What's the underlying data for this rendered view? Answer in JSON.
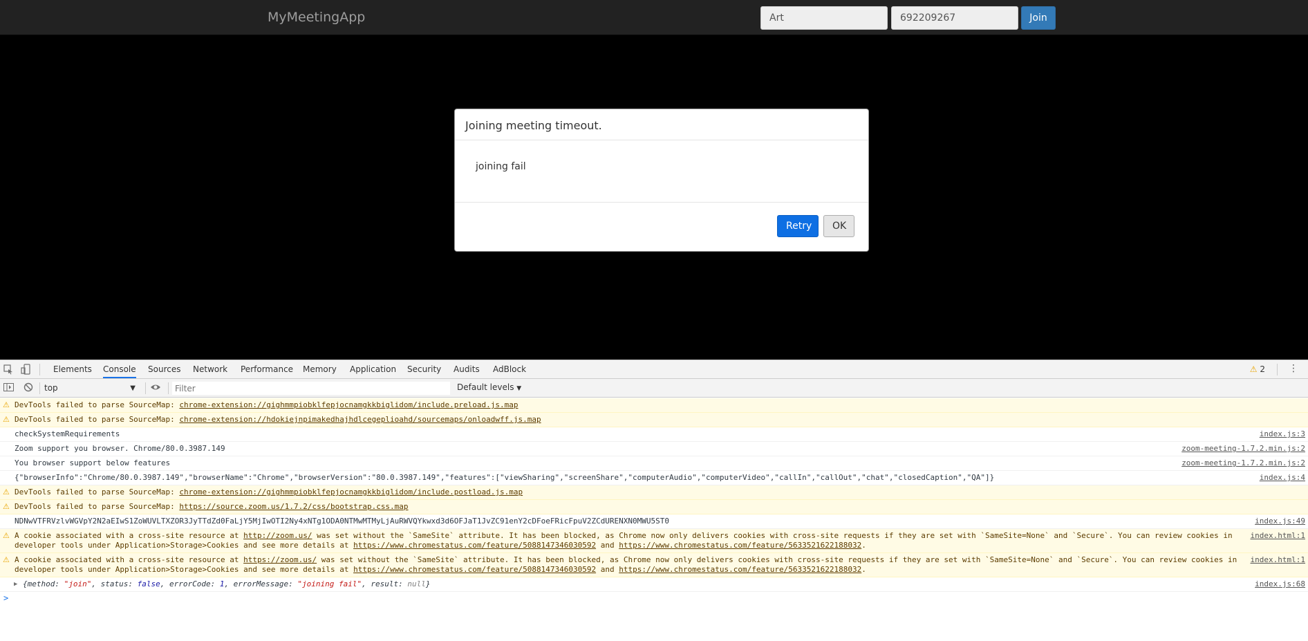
{
  "app": {
    "brand": "MyMeetingApp",
    "name_value": "Art",
    "meeting_value": "692209267",
    "join_label": "Join"
  },
  "modal": {
    "title": "Joining meeting timeout.",
    "body": "joining fail",
    "retry_label": "Retry",
    "ok_label": "OK"
  },
  "devtools": {
    "tabs": [
      "Elements",
      "Console",
      "Sources",
      "Network",
      "Performance",
      "Memory",
      "Application",
      "Security",
      "Audits",
      "AdBlock"
    ],
    "active_tab": "Console",
    "warning_count": "2",
    "context": "top",
    "filter_placeholder": "Filter",
    "levels": "Default levels"
  },
  "console": {
    "r1": {
      "text": "DevTools failed to parse SourceMap: ",
      "link": "chrome-extension://gighmmpiobklfepjocnamgkkbiglidom/include.preload.js.map"
    },
    "r2": {
      "text": "DevTools failed to parse SourceMap: ",
      "link": "chrome-extension://hdokiejnpimakedhajhdlcegeplioahd/sourcemaps/onloadwff.js.map"
    },
    "r3": {
      "text": "checkSystemRequirements",
      "src": "index.js:3"
    },
    "r4": {
      "text": "Zoom support you browser. Chrome/80.0.3987.149",
      "src": "zoom-meeting-1.7.2.min.js:2"
    },
    "r5": {
      "text": "You browser support below features",
      "src": "zoom-meeting-1.7.2.min.js:2"
    },
    "r6": {
      "text": "{\"browserInfo\":\"Chrome/80.0.3987.149\",\"browserName\":\"Chrome\",\"browserVersion\":\"80.0.3987.149\",\"features\":[\"viewSharing\",\"screenShare\",\"computerAudio\",\"computerVideo\",\"callIn\",\"callOut\",\"chat\",\"closedCaption\",\"QA\"]}",
      "src": "index.js:4"
    },
    "r7": {
      "text": "DevTools failed to parse SourceMap: ",
      "link": "chrome-extension://gighmmpiobklfepjocnamgkkbiglidom/include.postload.js.map"
    },
    "r8": {
      "text": "DevTools failed to parse SourceMap: ",
      "link": "https://source.zoom.us/1.7.2/css/bootstrap.css.map"
    },
    "r9": {
      "text": "NDNwVTFRVzlvWGVpY2N2aEIwS1ZoWUVLTXZOR3JyTTdZd0FaLjY5MjIwOTI2Ny4xNTg1ODA0NTMwMTMyLjAuRWVQYkwxd3d6OFJaT1JvZC91enY2cDFoeFRicFpuV2ZCdURENXN0MWU5ST0",
      "src": "index.js:49"
    },
    "r10": {
      "a": "A cookie associated with a cross-site resource at ",
      "l1": "http://zoom.us/",
      "b": " was set without the `SameSite` attribute. It has been blocked, as Chrome now only delivers cookies with cross-site requests if they are set with `SameSite=None` and `Secure`. You can review cookies in",
      "c": "developer tools under Application>Storage>Cookies and see more details at ",
      "l2": "https://www.chromestatus.com/feature/5088147346030592",
      "d": " and ",
      "l3": "https://www.chromestatus.com/feature/5633521622188032",
      "e": ".",
      "src": "index.html:1"
    },
    "r11": {
      "a": "A cookie associated with a cross-site resource at ",
      "l1": "https://zoom.us/",
      "b": " was set without the `SameSite` attribute. It has been blocked, as Chrome now only delivers cookies with cross-site requests if they are set with `SameSite=None` and `Secure`. You can review cookies in",
      "c": "developer tools under Application>Storage>Cookies and see more details at ",
      "l2": "https://www.chromestatus.com/feature/5088147346030592",
      "d": " and ",
      "l3": "https://www.chromestatus.com/feature/5633521622188032",
      "e": ".",
      "src": "index.html:1"
    },
    "r12": {
      "p1": "{method: ",
      "v1": "\"join\"",
      "p2": ", status: ",
      "v2": "false",
      "p3": ", errorCode: ",
      "v3": "1",
      "p4": ", errorMessage: ",
      "v4": "\"joining fail\"",
      "p5": ", result: ",
      "v5": "null",
      "p6": "}",
      "src": "index.js:68"
    },
    "prompt": ">"
  },
  "colors": {
    "navbar": "#222222",
    "join_button": "#337ab7",
    "retry_button": "#0e6fe3",
    "warning_row": "#fffbe5",
    "active_tab_underline": "#1a73e8"
  }
}
